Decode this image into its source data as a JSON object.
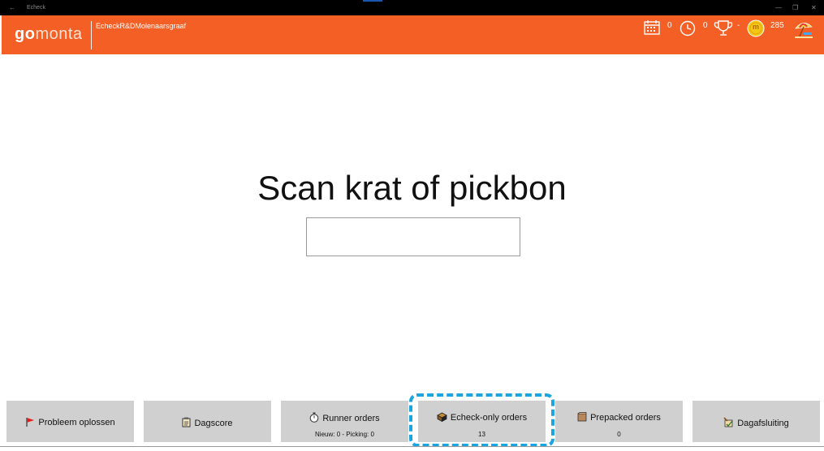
{
  "window": {
    "title": "Echeck",
    "back_glyph": "←",
    "minimize_glyph": "—",
    "restore_glyph": "❐",
    "close_glyph": "✕"
  },
  "header": {
    "logo_go": "go",
    "logo_monta": "monta",
    "station_name": "EcheckR&DMolenaarsgraaf",
    "brand_color": "#f45f25",
    "stats": {
      "calendar_count": "0",
      "clock_count": "0",
      "trophy_value": "-",
      "coin_label": "m",
      "coin_count": "285"
    },
    "icons": [
      "calendar-icon",
      "clock-icon",
      "trophy-icon",
      "coin-icon",
      "beach-umbrella-icon"
    ]
  },
  "main": {
    "prompt": "Scan krat of pickbon",
    "scan_input_value": ""
  },
  "buttons": [
    {
      "label": "Probleem oplossen",
      "sub": "",
      "icon": "red-flag-icon"
    },
    {
      "label": "Dagscore",
      "sub": "",
      "icon": "clipboard-icon"
    },
    {
      "label": "Runner orders",
      "sub": "Nieuw: 0 - Picking: 0",
      "icon": "stopwatch-icon"
    },
    {
      "label": "Echeck-only orders",
      "sub": "13",
      "icon": "box-icon"
    },
    {
      "label": "Prepacked orders",
      "sub": "0",
      "icon": "package-icon"
    },
    {
      "label": "Dagafsluiting",
      "sub": "",
      "icon": "day-close-icon"
    }
  ],
  "highlight_color": "#1aa5e0"
}
